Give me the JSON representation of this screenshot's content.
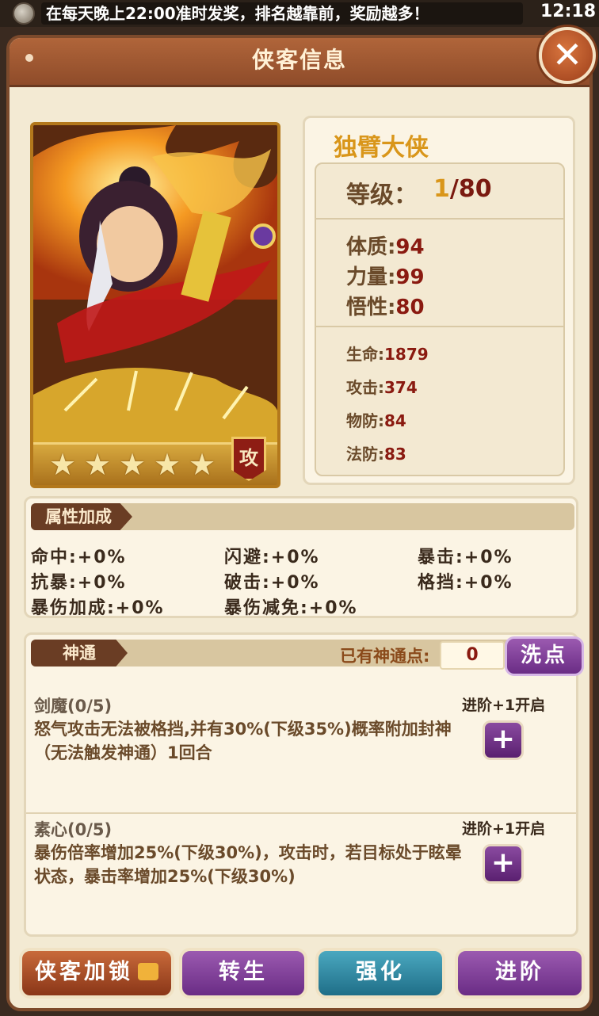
{
  "status_bar": {
    "marquee_text": "在每天晚上22:00准时发奖，排名越靠前，奖励越多！",
    "time": "12:18"
  },
  "header": {
    "title": "侠客信息",
    "close_label": "✕"
  },
  "hero": {
    "name": "独臂大侠",
    "class_badge": "攻",
    "stars": 5,
    "level_label": "等级：",
    "level_current": "1",
    "level_max": "/80",
    "base_stats": [
      {
        "label": "体质:",
        "value": "94"
      },
      {
        "label": "力量:",
        "value": "99"
      },
      {
        "label": "悟性:",
        "value": "80"
      }
    ],
    "combat_stats": [
      {
        "label": "生命:",
        "value": "1879"
      },
      {
        "label": "攻击:",
        "value": "374"
      },
      {
        "label": "物防:",
        "value": "84"
      },
      {
        "label": "法防:",
        "value": "83"
      }
    ]
  },
  "attribute_bonus": {
    "title": "属性加成",
    "items": [
      "命中:+0%",
      "闪避:+0%",
      "暴击:+0%",
      "抗暴:+0%",
      "破击:+0%",
      "格挡:+0%",
      "暴伤加成:+0%",
      "暴伤减免:+0%"
    ]
  },
  "divine": {
    "title": "神通",
    "points_label": "已有神通点:",
    "points_value": "0",
    "reset_label": "洗点",
    "skills": [
      {
        "name": "剑魔(0/5)",
        "unlock": "进阶+1开启",
        "desc": "怒气攻击无法被格挡,并有30%(下级35%)概率附加封神（无法触发神通）1回合"
      },
      {
        "name": "素心(0/5)",
        "unlock": "进阶+1开启",
        "desc": "暴伤倍率增加25%(下级30%)，攻击时，若目标处于眩晕状态，暴击率增加25%(下级30%)"
      }
    ]
  },
  "buttons": {
    "lock": "侠客加锁",
    "rebirth": "转生",
    "enhance": "强化",
    "advance": "进阶"
  }
}
